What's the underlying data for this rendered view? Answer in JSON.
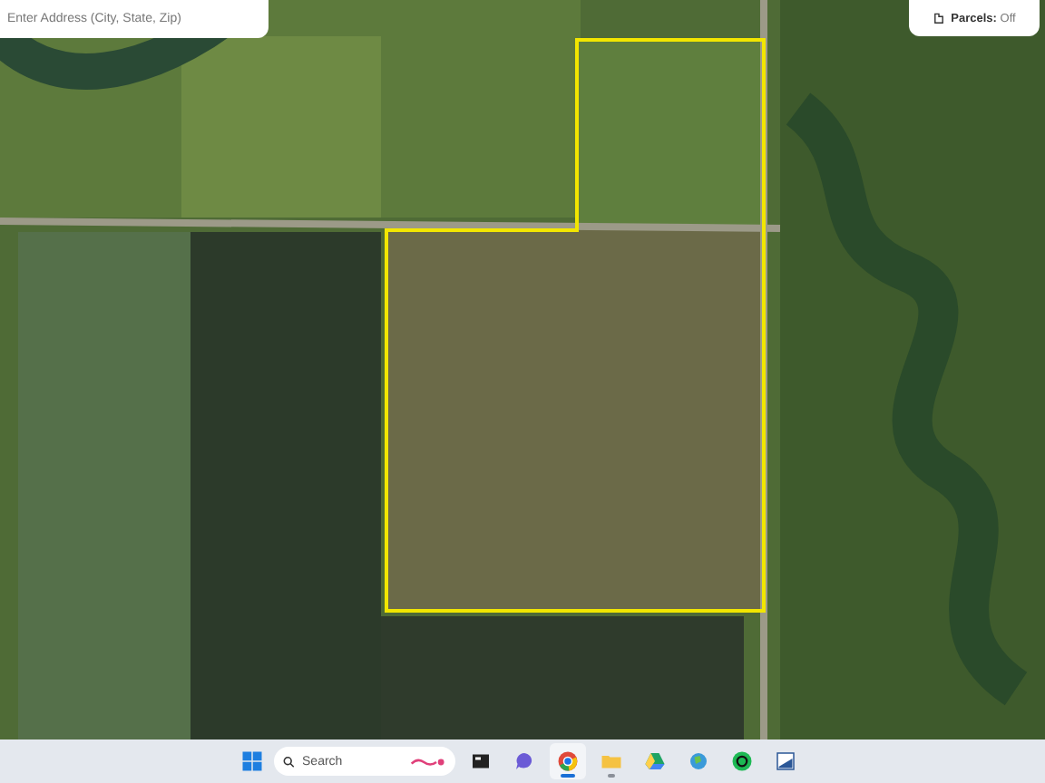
{
  "address_search": {
    "placeholder": "Enter Address (City, State, Zip)"
  },
  "parcels": {
    "label": "Parcels:",
    "value": "Off"
  },
  "taskbar": {
    "search_placeholder": "Search",
    "apps": [
      {
        "kind": "terminal",
        "selected": false,
        "running": false
      },
      {
        "kind": "chat",
        "selected": false,
        "running": false
      },
      {
        "kind": "browser",
        "selected": true,
        "running": true
      },
      {
        "kind": "folder",
        "selected": false,
        "running": true
      },
      {
        "kind": "drive",
        "selected": false,
        "running": false
      },
      {
        "kind": "globe",
        "selected": false,
        "running": false
      },
      {
        "kind": "messenger",
        "selected": false,
        "running": false
      },
      {
        "kind": "document",
        "selected": false,
        "running": false
      }
    ]
  }
}
